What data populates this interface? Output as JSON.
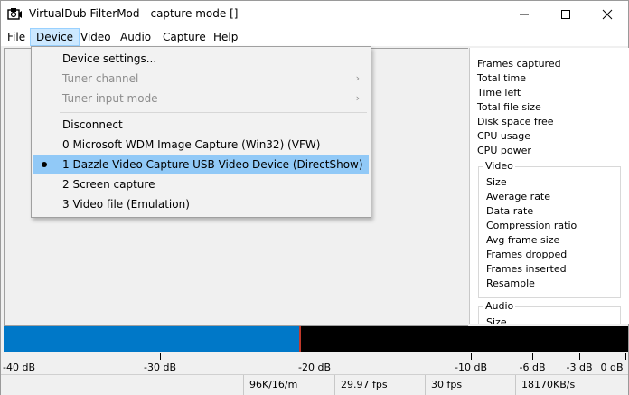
{
  "window": {
    "title": "VirtualDub FilterMod  - capture mode []"
  },
  "menubar": [
    {
      "pre": "",
      "u": "F",
      "post": "ile",
      "name": "menu-file"
    },
    {
      "pre": "",
      "u": "D",
      "post": "evice",
      "name": "menu-device"
    },
    {
      "pre": "",
      "u": "V",
      "post": "ideo",
      "name": "menu-video"
    },
    {
      "pre": "",
      "u": "A",
      "post": "udio",
      "name": "menu-audio"
    },
    {
      "pre": "",
      "u": "C",
      "post": "apture",
      "name": "menu-capture"
    },
    {
      "pre": "",
      "u": "H",
      "post": "elp",
      "name": "menu-help"
    }
  ],
  "device_menu": {
    "items": [
      {
        "label": "Device settings...",
        "disabled": false,
        "submenu": false,
        "checked": false
      },
      {
        "label": "Tuner channel",
        "disabled": true,
        "submenu": true,
        "checked": false
      },
      {
        "label": "Tuner input mode",
        "disabled": true,
        "submenu": true,
        "checked": false
      },
      {
        "label": "Disconnect",
        "disabled": false,
        "submenu": false,
        "checked": false
      },
      {
        "label": "0 Microsoft WDM Image Capture (Win32) (VFW)",
        "disabled": false,
        "submenu": false,
        "checked": false
      },
      {
        "label": "1 Dazzle Video Capture USB Video Device (DirectShow)",
        "disabled": false,
        "submenu": false,
        "checked": true,
        "selected": true
      },
      {
        "label": "2 Screen capture",
        "disabled": false,
        "submenu": false,
        "checked": false
      },
      {
        "label": "3 Video file (Emulation)",
        "disabled": false,
        "submenu": false,
        "checked": false
      }
    ]
  },
  "info_panel": {
    "stats": [
      "Frames captured",
      "Total time",
      "Time left",
      "Total file size",
      "Disk space free",
      "CPU usage",
      "CPU power"
    ],
    "video_group": {
      "title": "Video",
      "items": [
        "Size",
        "Average rate",
        "Data rate",
        "Compression ratio",
        "Avg frame size",
        "Frames dropped",
        "Frames inserted",
        "Resample"
      ]
    },
    "audio_group": {
      "title": "Audio",
      "items": [
        "Size"
      ]
    }
  },
  "audio_meter": {
    "level_fraction": 0.473,
    "colors": {
      "fill": "#0078c8",
      "background": "#000000",
      "peak": "#c0392b"
    },
    "scale_labels": [
      "-40 dB",
      "-30 dB",
      "-20 dB",
      "-10 dB",
      "-6 dB",
      "-3 dB",
      "0 dB"
    ]
  },
  "statusbar": [
    "96K/16/m",
    "29.97 fps",
    "30 fps",
    "18170KB/s"
  ]
}
